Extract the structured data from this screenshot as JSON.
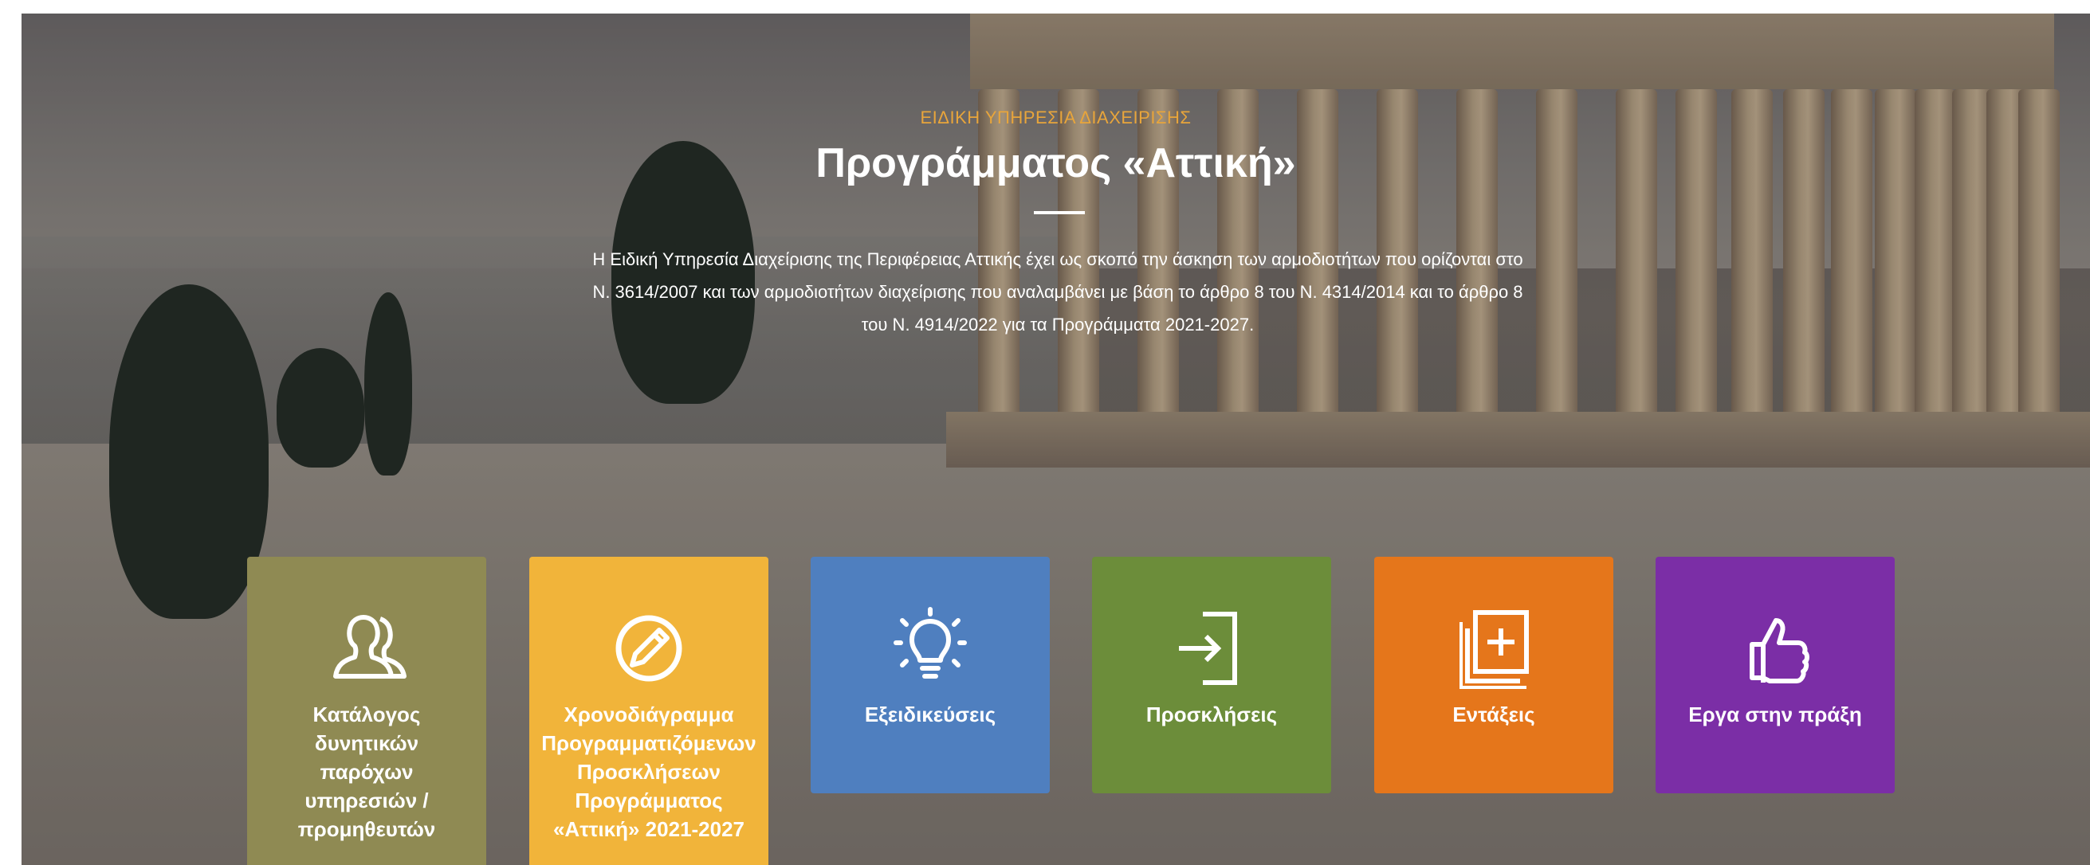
{
  "hero": {
    "eyebrow": "ΕΙΔΙΚΗ ΥΠΗΡΕΣΙΑ ΔΙΑΧΕΙΡΙΣΗΣ",
    "title": "Προγράμματος «Αττική»",
    "description_line1": "Η Ειδική Υπηρεσία Διαχείρισης της Περιφέρειας Αττικής έχει ως σκοπό την άσκηση των αρμοδιοτήτων που ορίζονται στο",
    "description_line2": "Ν. 3614/2007 και των αρμοδιοτήτων διαχείρισης που αναλαμβάνει με βάση το άρθρο 8 του Ν. 4314/2014 και το άρθρο 8",
    "description_line3": "του Ν. 4914/2022 για τα Προγράμματα 2021-2027."
  },
  "colors": {
    "eyebrow": "#e8a53b",
    "tile_catalog": "#8f8a53",
    "tile_schedule": "#f1b43a",
    "tile_specializations": "#4f7fbf",
    "tile_calls": "#6c8d3a",
    "tile_inclusions": "#e5761b",
    "tile_projects": "#7b2ea6"
  },
  "tiles": [
    {
      "icon": "users-icon",
      "lines": [
        "Κατάλογος",
        "δυνητικών",
        "παρόχων",
        "υπηρεσιών /",
        "προμηθευτών"
      ]
    },
    {
      "icon": "pencil-circle-icon",
      "lines": [
        "Χρονοδιάγραμμα",
        "Προγραμματιζόμενων",
        "Προσκλήσεων",
        "Προγράμματος",
        "«Αττική» 2021-2027"
      ]
    },
    {
      "icon": "lightbulb-icon",
      "lines": [
        "Εξειδικεύσεις"
      ]
    },
    {
      "icon": "sign-in-icon",
      "lines": [
        "Προσκλήσεις"
      ]
    },
    {
      "icon": "add-copy-icon",
      "lines": [
        "Εντάξεις"
      ]
    },
    {
      "icon": "thumbs-up-icon",
      "lines": [
        "Εργα στην πράξη"
      ]
    }
  ]
}
